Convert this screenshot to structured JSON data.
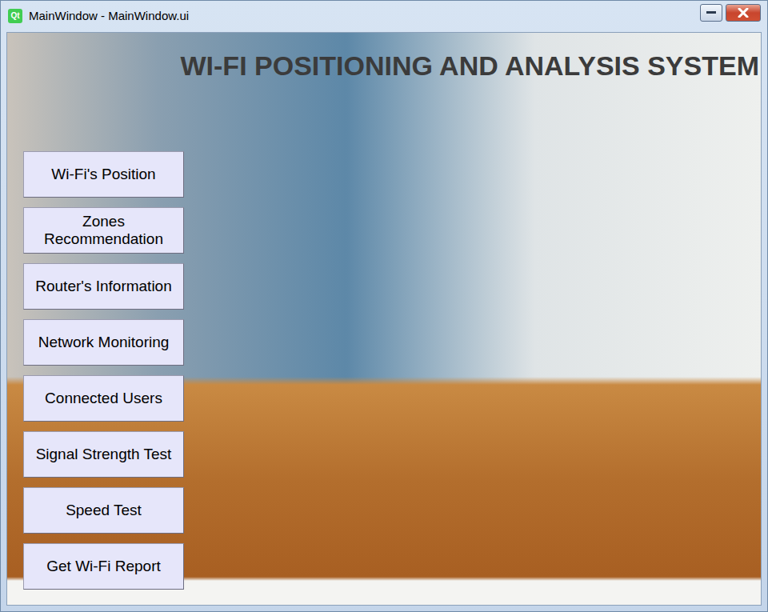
{
  "window": {
    "title": "MainWindow - MainWindow.ui",
    "app_icon": "Qt"
  },
  "heading": "WI-FI POSITIONING AND ANALYSIS SYSTEM",
  "buttons": [
    "Wi-Fi's Position",
    "Zones Recommendation",
    "Router's Information",
    "Network Monitoring",
    "Connected Users",
    "Signal Strength Test",
    "Speed Test",
    "Get Wi-Fi Report"
  ]
}
